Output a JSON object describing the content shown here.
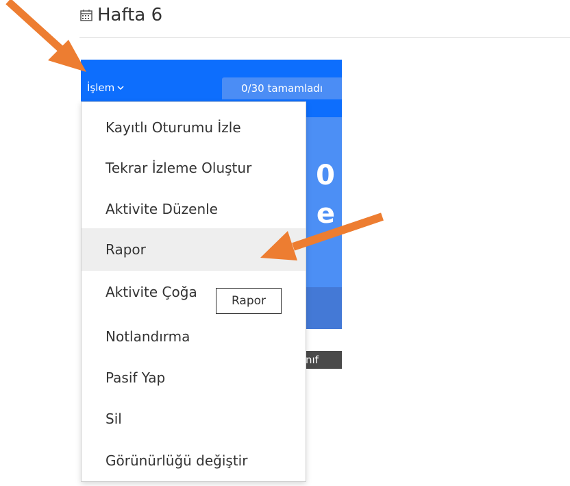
{
  "page": {
    "title": "Hafta 6"
  },
  "card": {
    "action_label": "İşlem",
    "progress_text": "0/30 tamamladı",
    "partial_text_1": "0",
    "partial_text_2": "e",
    "dark_badge_text": "nıf"
  },
  "dropdown": {
    "items": [
      {
        "label": "Kayıtlı Oturumu İzle"
      },
      {
        "label": "Tekrar İzleme Oluştur"
      },
      {
        "label": "Aktivite Düzenle"
      },
      {
        "label": "Rapor"
      },
      {
        "label": "Aktivite Çoğa"
      },
      {
        "label": "Notlandırma"
      },
      {
        "label": "Pasif Yap"
      },
      {
        "label": "Sil"
      },
      {
        "label": "Görünürlüğü değiştir"
      }
    ]
  },
  "tooltip": {
    "text": "Rapor"
  },
  "colors": {
    "accent": "#0d6efd",
    "annotation_arrow": "#ed7d31",
    "hover_bg": "#eeeeee"
  },
  "icons": {
    "title_icon": "calendar-icon",
    "toggle_icon": "chevron-down-icon"
  }
}
